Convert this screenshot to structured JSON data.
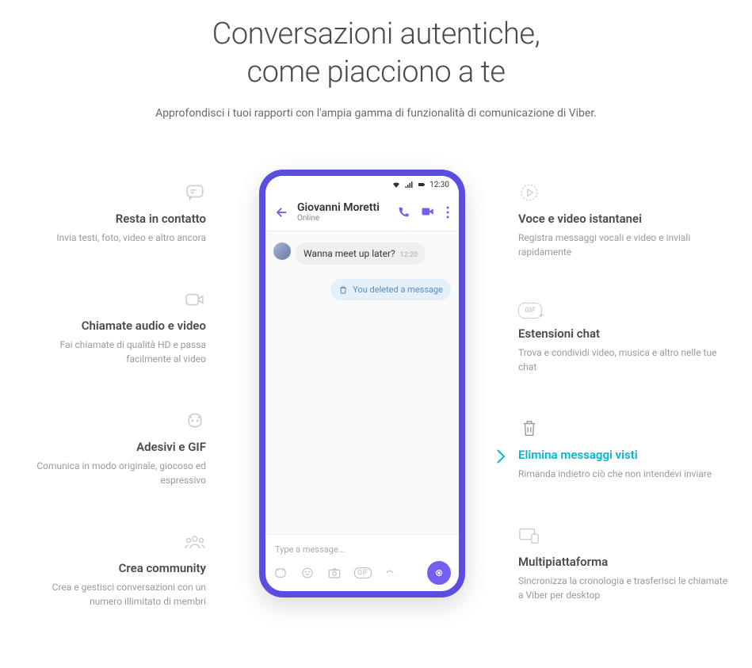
{
  "hero": {
    "title_line1": "Conversazioni autentiche,",
    "title_line2": "come piacciono a te",
    "subtitle": "Approfondisci i tuoi rapporti con l'ampia gamma di funzionalità di comunicazione di Viber."
  },
  "features_left": [
    {
      "title": "Resta in contatto",
      "desc": "Invia testi, foto, video e altro ancora"
    },
    {
      "title": "Chiamate audio e video",
      "desc": "Fai chiamate di qualità HD e passa facilmente al video"
    },
    {
      "title": "Adesivi e GIF",
      "desc": "Comunica in modo originale, giocoso ed espressivo"
    },
    {
      "title": "Crea community",
      "desc": "Crea e gestisci conversazioni con un numero illimitato di membri"
    }
  ],
  "features_right": [
    {
      "title": "Voce e video istantanei",
      "desc": "Registra messaggi vocali e video e inviali rapidamente"
    },
    {
      "title": "Estensioni chat",
      "desc": "Trova e condividi video, musica e altro nelle tue chat"
    },
    {
      "title": "Elimina messaggi visti",
      "desc": "Rimanda indietro ciò che non intendevi inviare"
    },
    {
      "title": "Multipiattaforma",
      "desc": "Sincronizza la cronologia e trasferisci le chiamate a Viber per desktop"
    }
  ],
  "phone": {
    "time": "12:30",
    "contact_name": "Giovanni Moretti",
    "contact_status": "Online",
    "msg_text": "Wanna meet up later?",
    "msg_time": "12:20",
    "deleted_text": "You deleted a message",
    "input_placeholder": "Type a message...",
    "gif_label": "GIF"
  },
  "gif_badge": "GIF"
}
